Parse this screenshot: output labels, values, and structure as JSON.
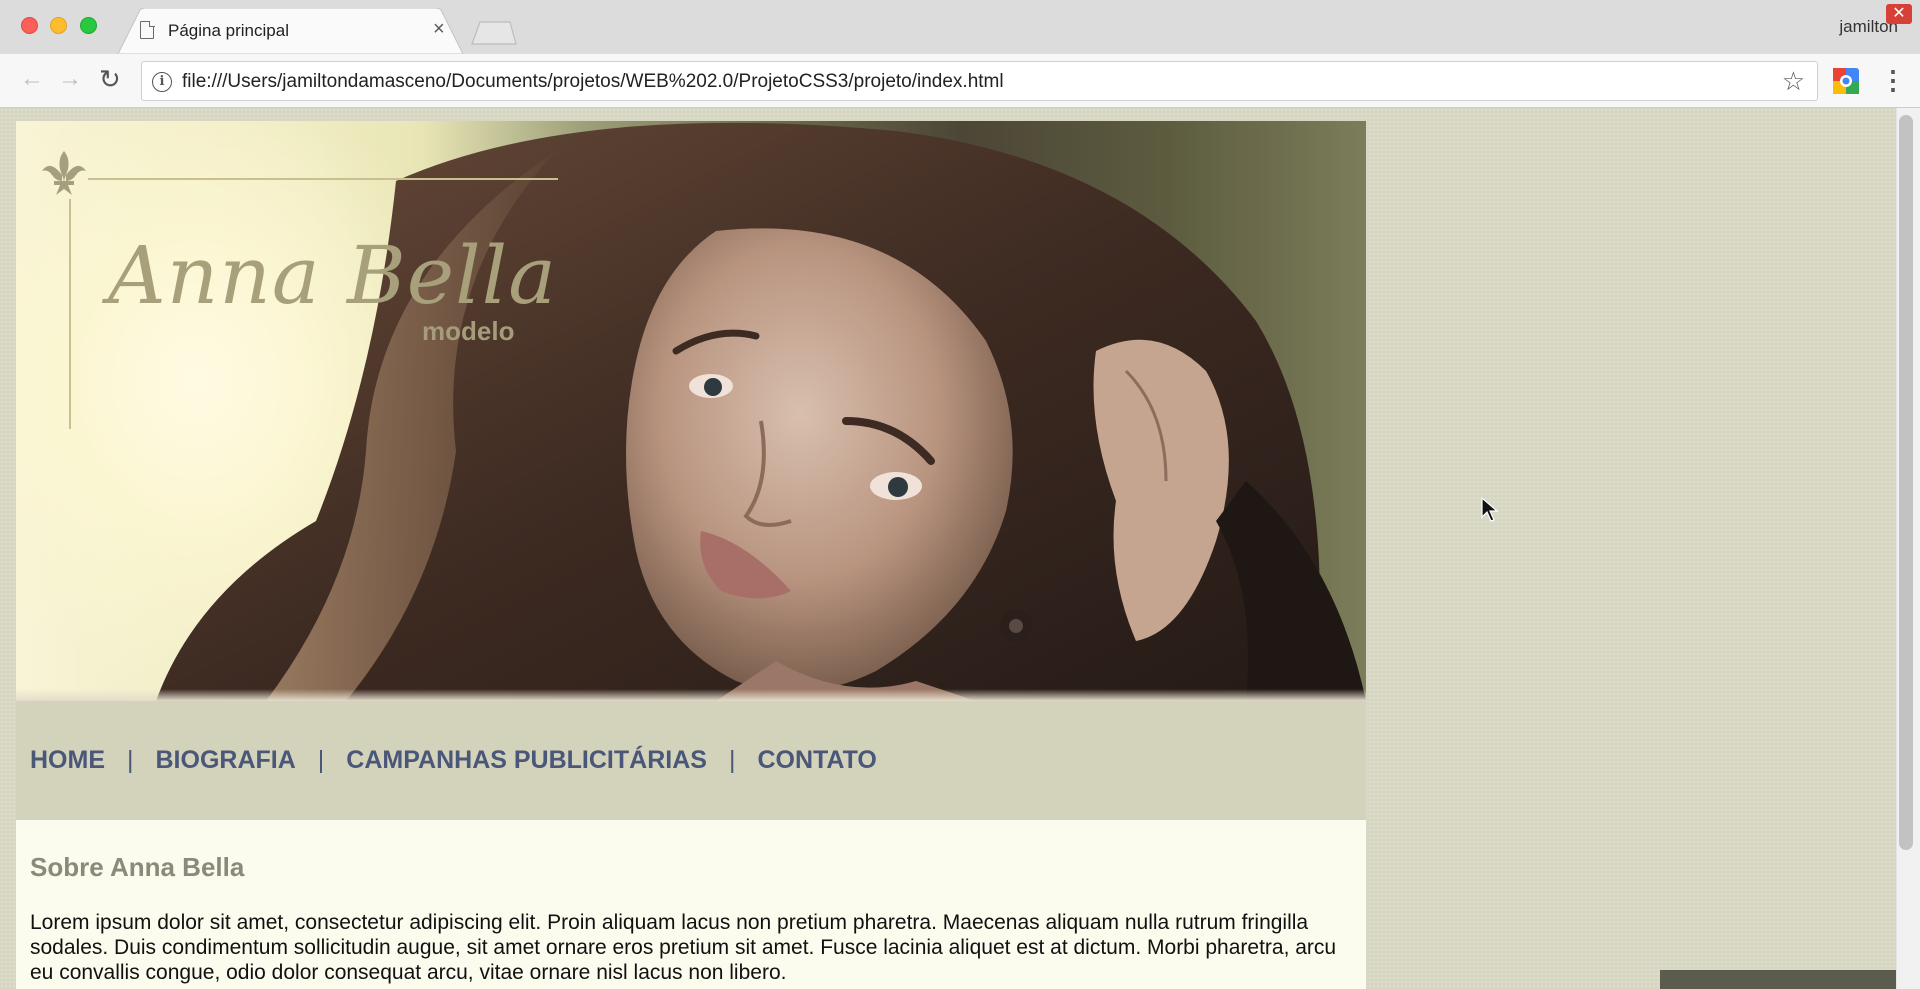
{
  "browser": {
    "tab": {
      "title": "Página principal",
      "close_glyph": "×"
    },
    "profile_name": "jamilton",
    "profile_close_glyph": "✕",
    "toolbar": {
      "back_glyph": "←",
      "forward_glyph": "→",
      "reload_glyph": "↻",
      "info_glyph": "i",
      "url": "file:///Users/jamiltondamasceno/Documents/projetos/WEB%202.0/ProjetoCSS3/projeto/index.html",
      "bookmark_glyph": "☆",
      "menu_glyph": "⋮"
    },
    "icons": {
      "page": "page-icon",
      "close": "close-icon",
      "back": "back-arrow-icon",
      "forward": "forward-arrow-icon",
      "reload": "reload-icon",
      "info": "info-icon",
      "star": "star-icon",
      "extension": "extension-icon",
      "menu": "kebab-menu-icon"
    }
  },
  "site": {
    "brand": {
      "name": "Anna Bella",
      "subtitle": "modelo"
    },
    "nav": {
      "items": [
        "HOME",
        "BIOGRAFIA",
        "CAMPANHAS PUBLICITÁRIAS",
        "CONTATO"
      ],
      "separator": "|"
    },
    "content": {
      "title": "Sobre Anna Bella",
      "paragraph": "Lorem ipsum dolor sit amet, consectetur adipiscing elit. Proin aliquam lacus non pretium pharetra. Maecenas aliquam nulla rutrum fringilla sodales. Duis condimentum sollicitudin augue, sit amet ornare eros pretium sit amet. Fusce lacinia aliquet est at dictum. Morbi pharetra, arcu eu convallis congue, odio dolor consequat arcu, vitae ornare nisl lacus non libero."
    },
    "colors": {
      "page_background": "#d6d6c2",
      "nav_background": "#d3d3bb",
      "nav_link": "#4b5779",
      "content_background": "#fbfbee",
      "heading": "#8a8a7a",
      "brand_text": "#a7a07a"
    }
  }
}
